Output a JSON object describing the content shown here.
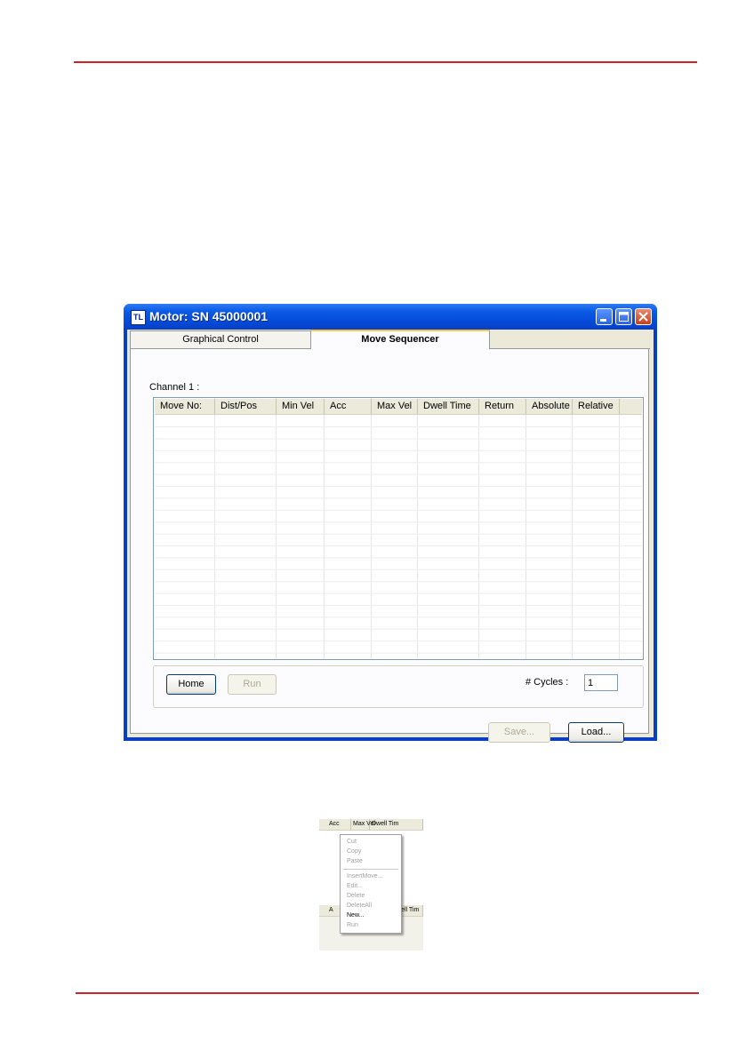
{
  "window": {
    "title": "Motor: SN 45000001",
    "app_icon_text": "TL"
  },
  "tabs": [
    {
      "label": "Graphical Control",
      "selected": false
    },
    {
      "label": "Move Sequencer",
      "selected": true
    }
  ],
  "channel_label": "Channel 1 :",
  "table": {
    "columns": [
      "Move No:",
      "Dist/Pos",
      "Min Vel",
      "Acc",
      "Max Vel",
      "Dwell Time",
      "Return",
      "Absolute",
      "Relative"
    ],
    "rows": []
  },
  "buttons": {
    "home": "Home",
    "run": "Run",
    "save": "Save...",
    "load": "Load..."
  },
  "cycles": {
    "label": "# Cycles :",
    "value": "1"
  },
  "context_menu": {
    "header_top": [
      "Acc",
      "Max Vel",
      "Dwell Tim"
    ],
    "header_bottom": [
      "A",
      "well Tim"
    ],
    "items": [
      {
        "label": "Cut",
        "enabled": false
      },
      {
        "label": "Copy",
        "enabled": false
      },
      {
        "label": "Paste",
        "enabled": false
      },
      {
        "label": "InsertMove...",
        "enabled": false
      },
      {
        "label": "Edit...",
        "enabled": false
      },
      {
        "label": "Delete",
        "enabled": false
      },
      {
        "label": "DeleteAll",
        "enabled": false
      },
      {
        "label": "New...",
        "enabled": true
      },
      {
        "label": "Run",
        "enabled": false
      }
    ]
  },
  "colors": {
    "rule": "#d32027",
    "titlebar": "#0548d6",
    "face": "#ece9d8"
  }
}
